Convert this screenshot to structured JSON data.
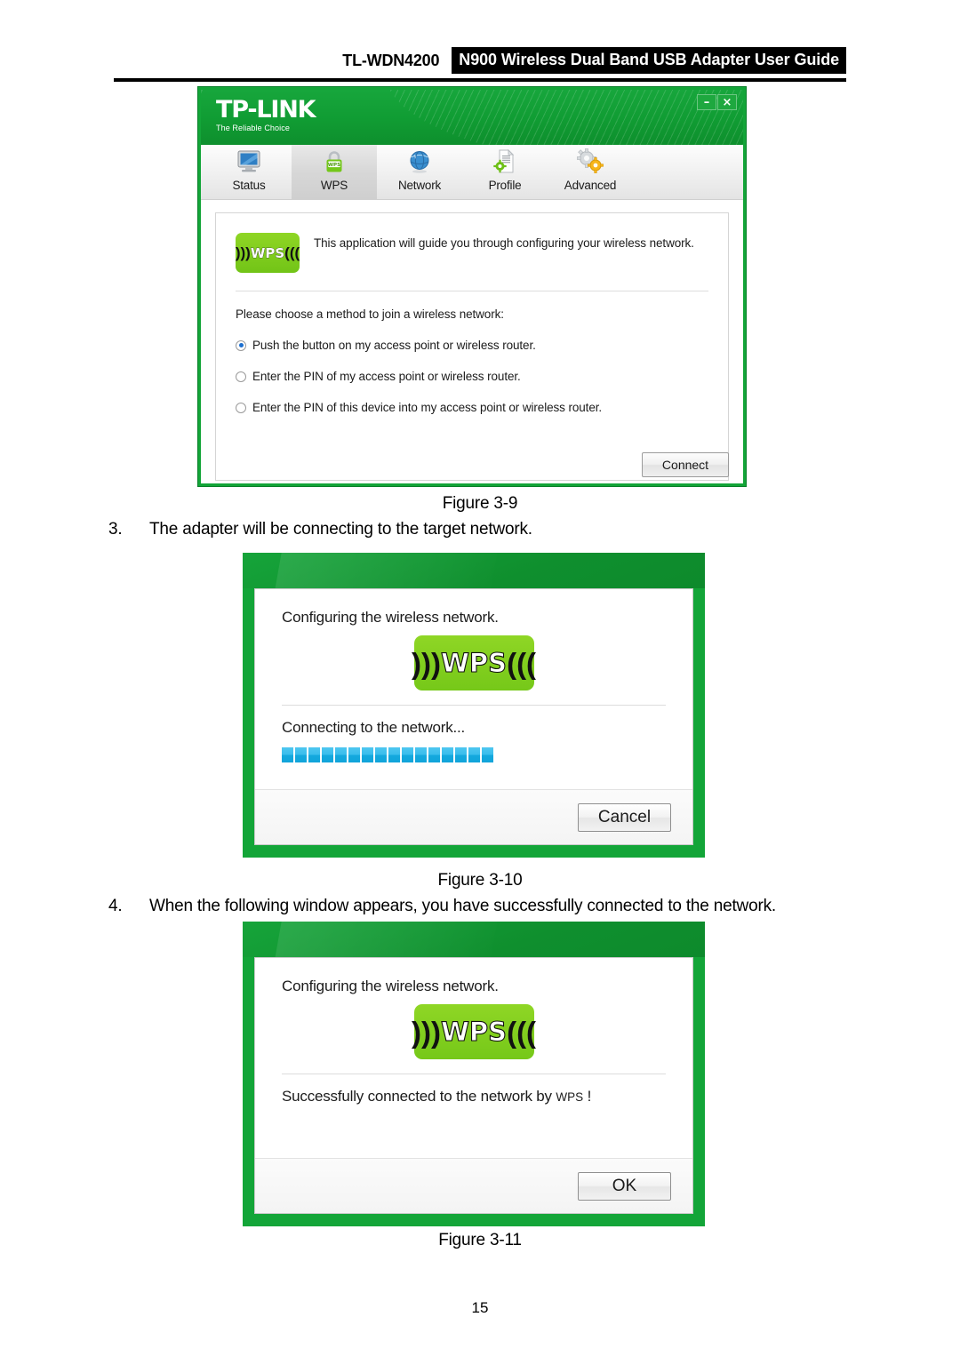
{
  "header": {
    "model": "TL-WDN4200",
    "title": "N900 Wireless Dual Band USB Adapter User Guide"
  },
  "page_number": "15",
  "steps": [
    {
      "num": "3.",
      "text": "The adapter will be connecting to the target network."
    },
    {
      "num": "4.",
      "text": "When the following window appears, you have successfully connected to the network."
    }
  ],
  "captions": {
    "fig9": "Figure 3-9",
    "fig10": "Figure 3-10",
    "fig11": "Figure 3-11"
  },
  "utility_window": {
    "brand": "TP-LINK",
    "tagline": "The Reliable Choice",
    "window_controls": {
      "minimize": "–",
      "close": "×"
    },
    "tabs": [
      {
        "label": "Status",
        "icon": "monitor-icon",
        "active": false
      },
      {
        "label": "WPS",
        "icon": "wps-lock-icon",
        "active": true
      },
      {
        "label": "Network",
        "icon": "globe-icon",
        "active": false
      },
      {
        "label": "Profile",
        "icon": "document-gear-icon",
        "active": false
      },
      {
        "label": "Advanced",
        "icon": "gears-icon",
        "active": false
      }
    ],
    "badge_text": "WPS",
    "intro_text": "This application will guide you through configuring your wireless network.",
    "choose_text": "Please choose a method to join a wireless network:",
    "options": [
      {
        "label": "Push the button on my access point or wireless router.",
        "selected": true
      },
      {
        "label": "Enter the PIN of my access point or wireless router.",
        "selected": false
      },
      {
        "label": "Enter the PIN of this device into my access point or wireless router.",
        "selected": false
      }
    ],
    "connect_label": "Connect"
  },
  "dialog_connecting": {
    "title": "Configuring the wireless network.",
    "badge_text": "WPS",
    "status": "Connecting to the network...",
    "progress_blocks": 16,
    "button_label": "Cancel"
  },
  "dialog_success": {
    "title": "Configuring the wireless network.",
    "badge_text": "WPS",
    "status_main": "Successfully connected to the network by ",
    "status_small": "WPS",
    "status_tail": " !",
    "button_label": "OK"
  },
  "colors": {
    "brand_green": "#13a538",
    "badge_green": "#8fd625",
    "progress_blue": "#2ab6e8",
    "radio_blue": "#1c6fd0"
  }
}
